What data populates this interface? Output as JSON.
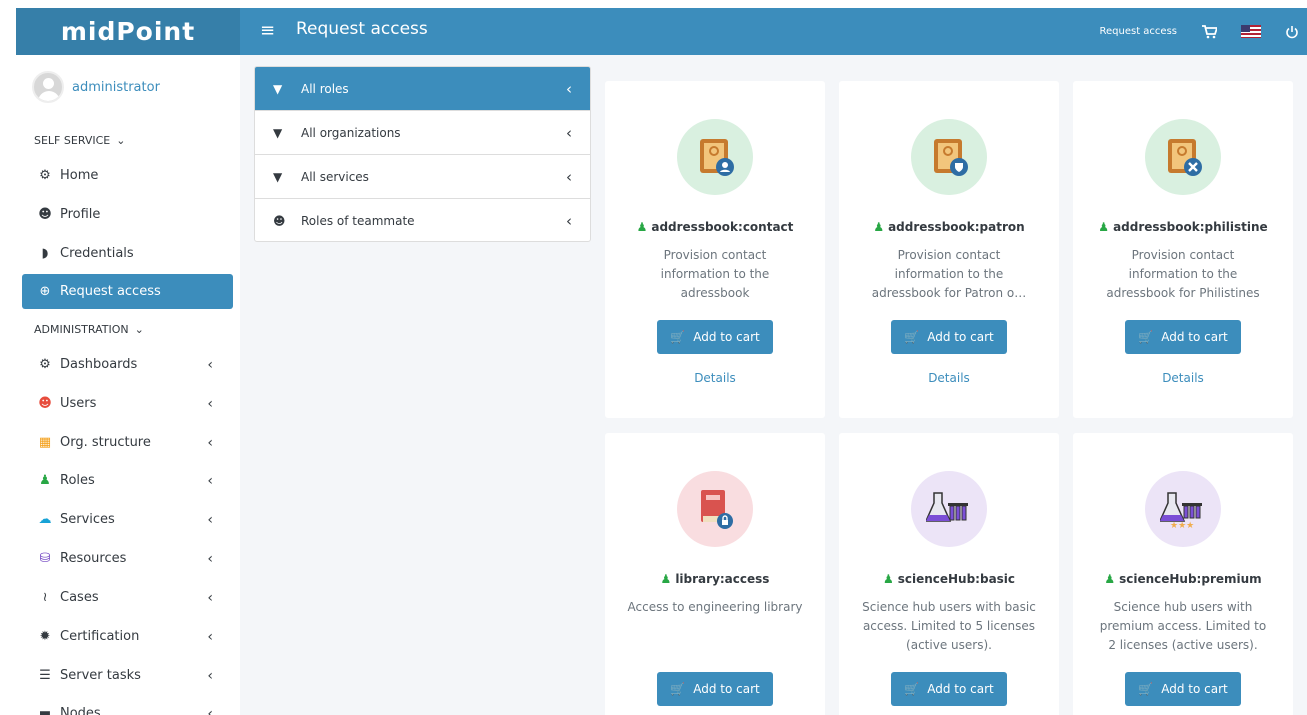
{
  "app": {
    "brand": "midPoint"
  },
  "header": {
    "menu_icon": "hamburger-icon",
    "title": "Request access",
    "request_access_link": "Request access",
    "cart_icon": "cart-icon",
    "language_icon": "us-flag-icon",
    "logout_icon": "power-icon"
  },
  "user": {
    "name": "administrator"
  },
  "sidebar": {
    "self_service_label": "SELF SERVICE",
    "self_service": [
      {
        "label": "Home",
        "icon": "⚙"
      },
      {
        "label": "Profile",
        "icon": "☻"
      },
      {
        "label": "Credentials",
        "icon": "◗"
      },
      {
        "label": "Request access",
        "icon": "⊕"
      }
    ],
    "administration_label": "ADMINISTRATION",
    "administration": [
      {
        "label": "Dashboards",
        "icon": "⚙"
      },
      {
        "label": "Users",
        "icon": "☻"
      },
      {
        "label": "Org. structure",
        "icon": "▦"
      },
      {
        "label": "Roles",
        "icon": "♟"
      },
      {
        "label": "Services",
        "icon": "☁"
      },
      {
        "label": "Resources",
        "icon": "⛁"
      },
      {
        "label": "Cases",
        "icon": "≀"
      },
      {
        "label": "Certification",
        "icon": "✹"
      },
      {
        "label": "Server tasks",
        "icon": "☰"
      },
      {
        "label": "Nodes",
        "icon": "▬"
      }
    ]
  },
  "filters": [
    {
      "label": "All roles",
      "icon": "▼"
    },
    {
      "label": "All organizations",
      "icon": "▼"
    },
    {
      "label": "All services",
      "icon": "▼"
    },
    {
      "label": "Roles of teammate",
      "icon": "☻"
    }
  ],
  "cards": [
    {
      "name": "addressbook:contact",
      "desc_lines": [
        "Provision contact",
        "information to the",
        "adressbook"
      ],
      "add_label": "Add to cart",
      "details_label": "Details",
      "circle_color": "#d9f0e0",
      "icon": "📒"
    },
    {
      "name": "addressbook:patron",
      "desc_lines": [
        "Provision contact",
        "information to the",
        "adressbook for Patron o…"
      ],
      "add_label": "Add to cart",
      "details_label": "Details",
      "circle_color": "#d9f0e0",
      "icon": "📒"
    },
    {
      "name": "addressbook:philistine",
      "desc_lines": [
        "Provision contact",
        "information to the",
        "adressbook for Philistines"
      ],
      "add_label": "Add to cart",
      "details_label": "Details",
      "circle_color": "#d9f0e0",
      "icon": "📒"
    },
    {
      "name": "library:access",
      "desc_lines": [
        "Access to engineering library",
        "",
        ""
      ],
      "add_label": "Add to cart",
      "circle_color": "#f9dde0",
      "icon": "📕"
    },
    {
      "name": "scienceHub:basic",
      "desc_lines": [
        "Science hub users with basic",
        "access. Limited to 5 licenses",
        "(active users)."
      ],
      "add_label": "Add to cart",
      "circle_color": "#ece4f7",
      "icon": "⚗"
    },
    {
      "name": "scienceHub:premium",
      "desc_lines": [
        "Science hub users with",
        "premium access. Limited to",
        "2 licenses (active users)."
      ],
      "add_label": "Add to cart",
      "circle_color": "#ece4f7",
      "icon": "⚗"
    }
  ],
  "colors": {
    "primary": "#3c8dbc",
    "brand_bg": "#367fa9",
    "role_green": "#28a745"
  }
}
